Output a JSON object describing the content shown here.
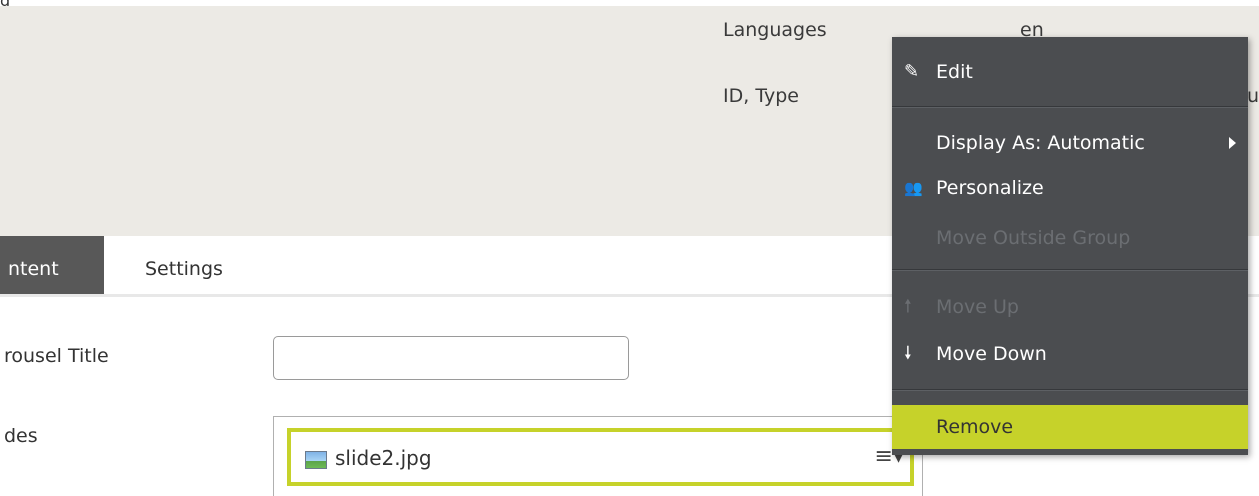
{
  "top_strip": {
    "clipped_text": "g"
  },
  "properties": {
    "languages_label": "Languages",
    "languages_value": "en",
    "id_type_label": "ID, Type",
    "id_type_value_partial": "u"
  },
  "tabs": [
    {
      "label": "ntent",
      "active": true
    },
    {
      "label": "Settings",
      "active": false
    }
  ],
  "form": {
    "carousel_title_label": "rousel Title",
    "carousel_title_value": "",
    "slides_label": "des",
    "slides": [
      {
        "name": "slide2.jpg",
        "icon": "image-file-icon"
      }
    ],
    "slide_menu_icon": "≡▾"
  },
  "context_menu": {
    "items": [
      {
        "label": "Edit",
        "icon": "pencil-icon",
        "glyph": "✎",
        "enabled": true
      },
      {
        "label": "Display As: Automatic",
        "icon": "",
        "glyph": "",
        "enabled": true,
        "submenu": true
      },
      {
        "label": "Personalize",
        "icon": "users-icon",
        "glyph": "👥",
        "enabled": true
      },
      {
        "label": "Move Outside Group",
        "icon": "",
        "glyph": "",
        "enabled": false
      },
      {
        "label": "Move Up",
        "icon": "arrow-up-icon",
        "glyph": "🠕",
        "enabled": false
      },
      {
        "label": "Move Down",
        "icon": "arrow-down-icon",
        "glyph": "🠗",
        "enabled": true
      },
      {
        "label": "Remove",
        "icon": "",
        "glyph": "",
        "enabled": true,
        "highlighted": true
      }
    ]
  },
  "colors": {
    "accent": "#c6d22a",
    "menu_bg": "#4b4d50",
    "header_bg": "#eceae5",
    "active_tab_bg": "#585858"
  }
}
